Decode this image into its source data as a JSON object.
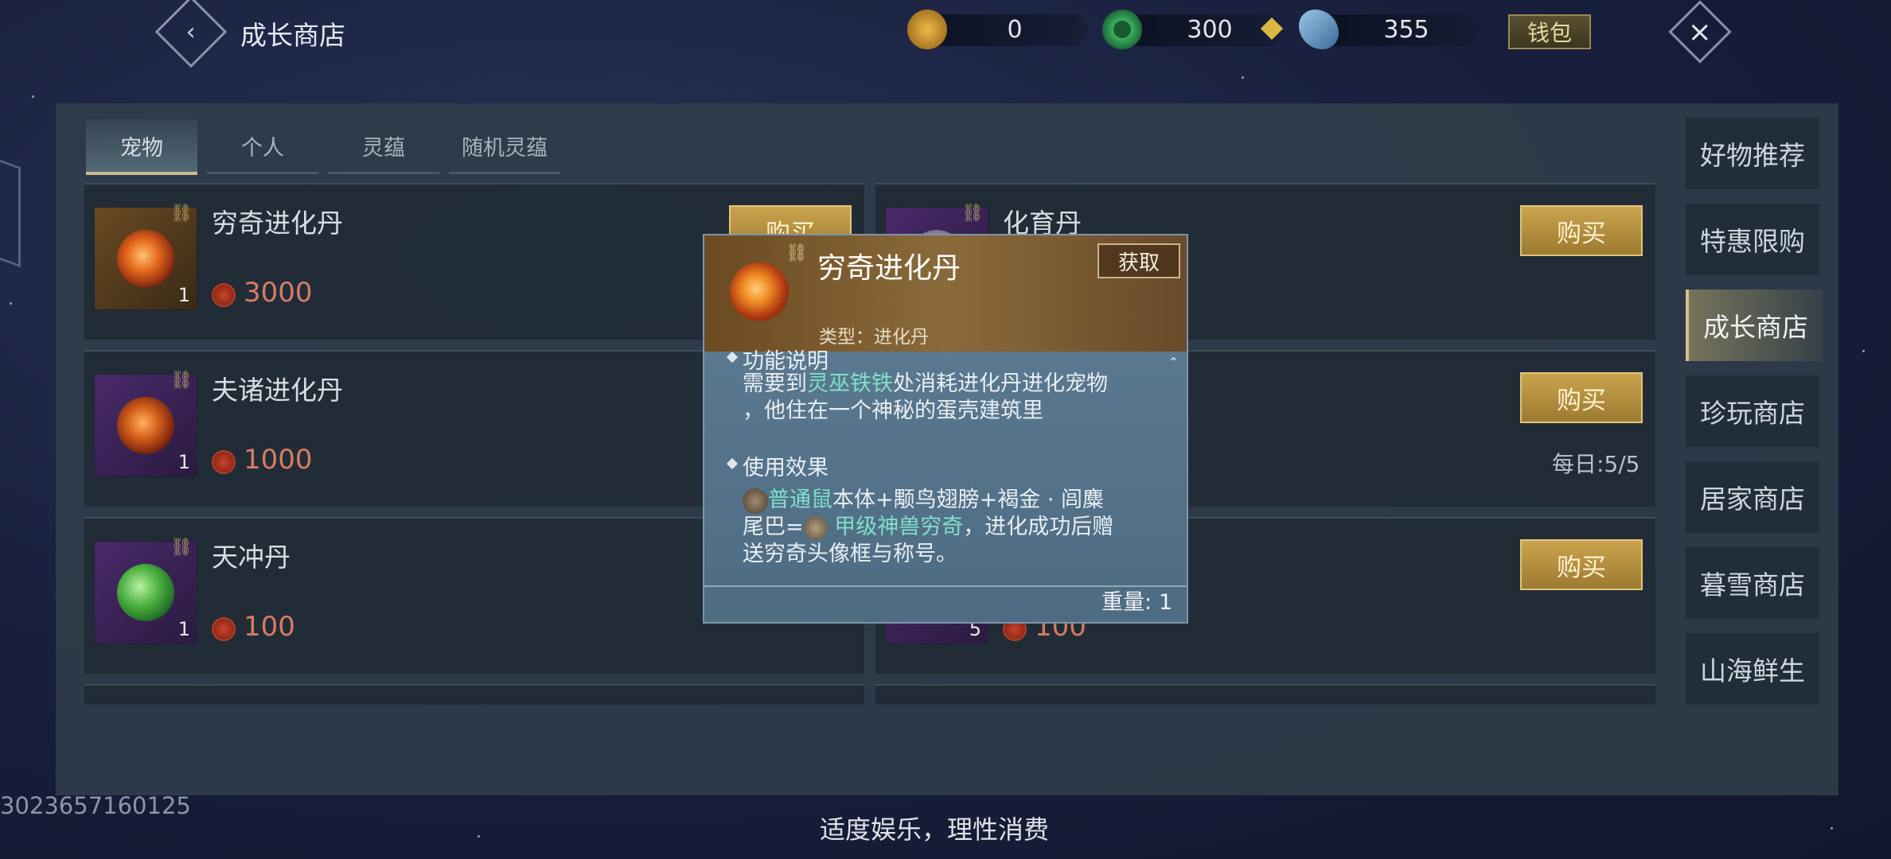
{
  "header": {
    "title": "成长商店",
    "currencies": [
      {
        "icon": "gold-pouch-icon",
        "value": "0"
      },
      {
        "icon": "jade-coin-icon",
        "value": "300"
      },
      {
        "icon": "feather-crystal-icon",
        "value": "355"
      }
    ],
    "wallet_label": "钱包"
  },
  "tabs": [
    {
      "label": "宠物",
      "active": true
    },
    {
      "label": "个人",
      "active": false
    },
    {
      "label": "灵蕴",
      "active": false
    },
    {
      "label": "随机灵蕴",
      "active": false
    }
  ],
  "items_left": [
    {
      "name": "穷奇进化丹",
      "qty": "1",
      "price": "3000",
      "buy_label": "购买"
    },
    {
      "name": "夫诸进化丹",
      "qty": "1",
      "price": "1000"
    },
    {
      "name": "天冲丹",
      "qty": "1",
      "price": "100"
    }
  ],
  "items_right": [
    {
      "name": "化育丹",
      "buy_label": "购买"
    },
    {
      "buy_label": "购买",
      "daily": "每日:5/5"
    },
    {
      "qty": "5",
      "price": "100",
      "buy_label": "购买"
    }
  ],
  "right_nav": [
    {
      "label": "好物推荐",
      "active": false
    },
    {
      "label": "特惠限购",
      "active": false
    },
    {
      "label": "成长商店",
      "active": true
    },
    {
      "label": "珍玩商店",
      "active": false
    },
    {
      "label": "居家商店",
      "active": false
    },
    {
      "label": "暮雪商店",
      "active": false
    },
    {
      "label": "山海鲜生",
      "active": false
    }
  ],
  "tooltip": {
    "title": "穷奇进化丹",
    "get_label": "获取",
    "type_text": "类型：进化丹",
    "section1_title": "功能说明",
    "section1_line1_pre": "需要到",
    "section1_line1_hl": "灵巫铁铁",
    "section1_line1_post": "处消耗进化丹进化宠物",
    "section1_line2": "，他住在一个神秘的蛋壳建筑里",
    "section2_title": "使用效果",
    "section2_line1_hl": "普通鼠",
    "section2_line1_post": "本体+颙鸟翅膀+褐金 · 闾麋",
    "section2_line2_pre": "尾巴=",
    "section2_line2_hl": "甲级神兽穷奇",
    "section2_line2_post": "，进化成功后赠",
    "section2_line3": "送穷奇头像框与称号。",
    "weight": "重量: 1"
  },
  "footer_note": "适度娱乐，理性消费",
  "uid": "3023657160125"
}
